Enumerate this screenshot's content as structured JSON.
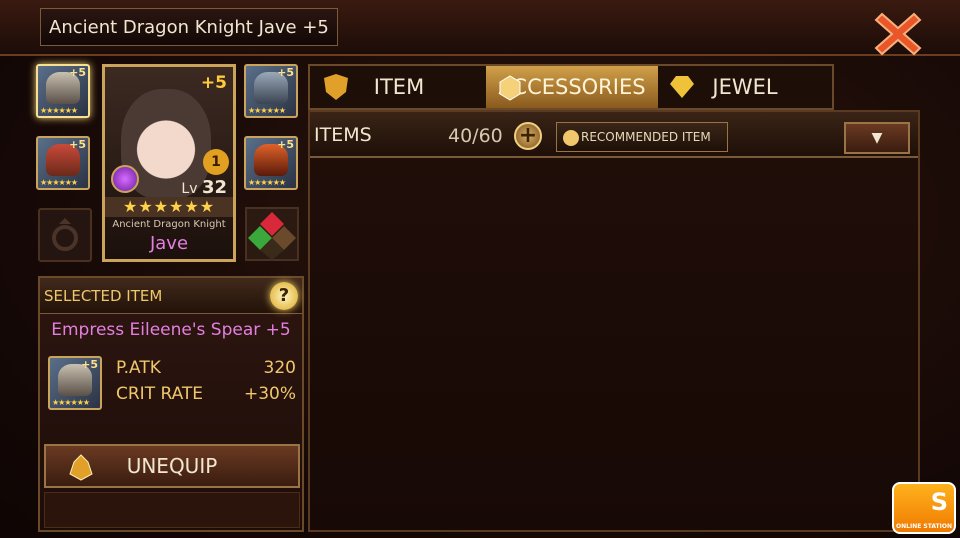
{
  "header": {
    "title": "Ancient Dragon Knight Jave +5"
  },
  "hero": {
    "plus": "+5",
    "rank": "1",
    "level_prefix": "Lv",
    "level": "32",
    "stars": "★★★★★★",
    "class": "Ancient Dragon Knight",
    "name": "Jave",
    "equip_slots": [
      {
        "plus": "+5",
        "stars": "★★★★★★",
        "icon": "spear-icon",
        "selected": true
      },
      {
        "plus": "+5",
        "stars": "★★★★★★",
        "icon": "armor-icon"
      },
      {
        "plus": "",
        "stars": "",
        "icon": "ring-empty-icon"
      },
      {
        "plus": "+5",
        "stars": "★★★★★★",
        "icon": "helmet-icon"
      },
      {
        "plus": "+5",
        "stars": "★★★★★★",
        "icon": "gauntlet-icon"
      },
      {
        "plus": "",
        "stars": "",
        "icon": "gem-slot-icon"
      }
    ]
  },
  "selected_item": {
    "header": "SELECTED ITEM",
    "help": "?",
    "name": "Empress Eileene's Spear +5",
    "icon_plus": "+5",
    "icon_stars": "★★★★★★",
    "stats": [
      {
        "label": "P.ATK",
        "value": "320"
      },
      {
        "label": "CRIT RATE",
        "value": "+30%"
      }
    ],
    "unequip_label": "UNEQUIP"
  },
  "tabs": [
    {
      "label": "ITEM",
      "icon": "shield-icon",
      "active": false
    },
    {
      "label": "ACCESSORIES",
      "icon": "gem-icon",
      "active": true
    },
    {
      "label": "JEWEL",
      "icon": "diamond-icon",
      "active": false
    }
  ],
  "inventory": {
    "title": "ITEMS",
    "count": "40/60",
    "add": "+",
    "recommended_label": "RECOMMENDED ITEM",
    "dropdown": "▼"
  },
  "watermark": {
    "letter": "S",
    "text": "ONLINE STATION"
  },
  "colors": {
    "accent_gold": "#f0c76a",
    "hero_name": "#e37fe0",
    "close_red": "#e9562a"
  }
}
